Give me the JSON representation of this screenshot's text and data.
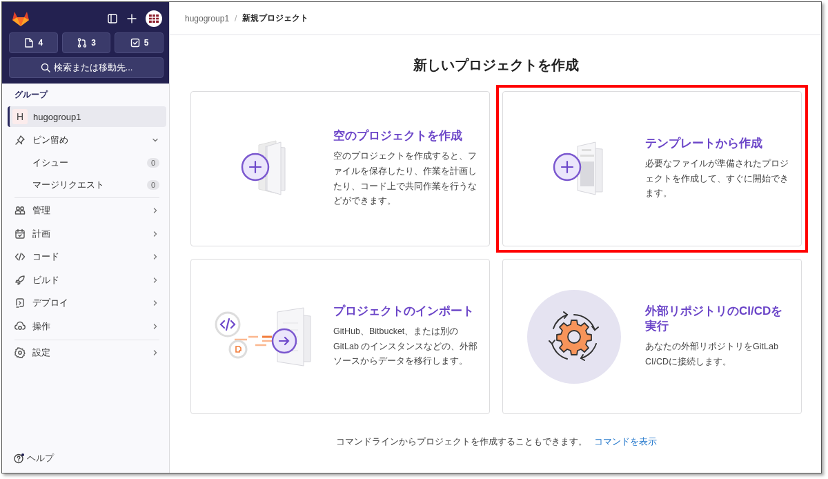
{
  "sidebar": {
    "counters": [
      {
        "count": "4"
      },
      {
        "count": "3"
      },
      {
        "count": "5"
      }
    ],
    "search": {
      "placeholder": "検索または移動先..."
    },
    "section_label": "グループ",
    "context": {
      "avatar": "H",
      "name": "hugogroup1",
      "selected": true
    },
    "pinned": {
      "label": "ピン留め",
      "expanded": true,
      "items": [
        {
          "label": "イシュー",
          "count": "0"
        },
        {
          "label": "マージリクエスト",
          "count": "0"
        }
      ]
    },
    "nav": [
      {
        "label": "管理"
      },
      {
        "label": "計画"
      },
      {
        "label": "コード"
      },
      {
        "label": "ビルド"
      },
      {
        "label": "デプロイ"
      },
      {
        "label": "操作"
      }
    ],
    "settings": {
      "label": "設定"
    },
    "help": {
      "label": "ヘルプ"
    }
  },
  "breadcrumb_separator": "/",
  "breadcrumb": [
    {
      "label": "hugogroup1",
      "current": false
    },
    {
      "label": "新規プロジェクト",
      "current": true
    }
  ],
  "title": "新しいプロジェクトを作成",
  "cards": [
    {
      "title": "空のプロジェクトを作成",
      "description": "空のプロジェクトを作成すると、ファイルを保存したり、作業を計画したり、コード上で共同作業を行うなどができます。",
      "highlighted": false
    },
    {
      "title": "テンプレートから作成",
      "description": "必要なファイルが準備されたプロジェクトを作成して、すぐに開始できます。",
      "highlighted": true
    },
    {
      "title": "プロジェクトのインポート",
      "description": "GitHub、Bitbucket、または別のGitLab のインスタンスなどの、外部ソースからデータを移行します。",
      "highlighted": false
    },
    {
      "title": "外部リポジトリのCI/CDを実行",
      "description": "あなたの外部リポジトリをGitLab CI/CDに接続します。",
      "highlighted": false
    }
  ],
  "footer": {
    "text": "コマンドラインからプロジェクトを作成することもできます。",
    "link": "コマンドを表示"
  }
}
